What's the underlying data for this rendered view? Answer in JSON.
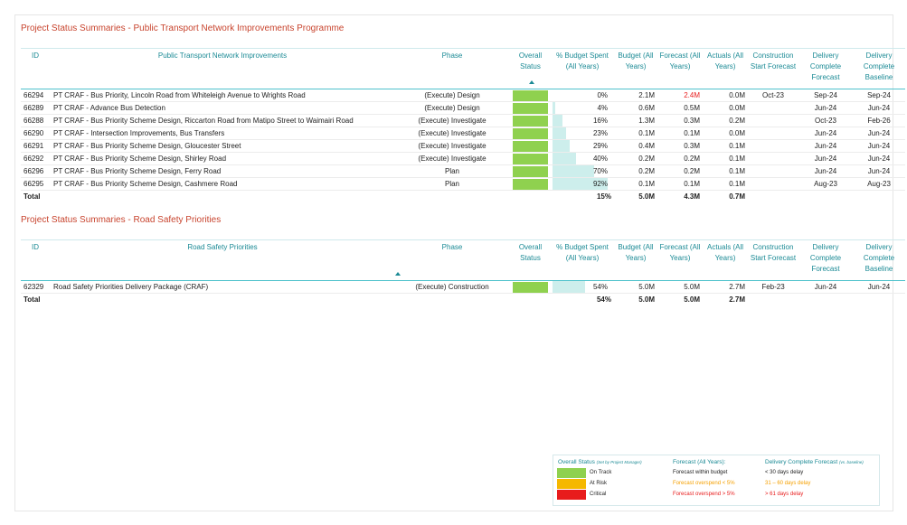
{
  "colors": {
    "on_track": "#8fd14f",
    "at_risk": "#f5b800",
    "critical": "#e81c1c",
    "header_teal": "#1b8a95",
    "title_red": "#c8442e",
    "over_budget_text": "#e81c1c",
    "budget_bar": "#cdeeec"
  },
  "section1": {
    "title": "Project Status Summaries - Public Transport Network Improvements Programme",
    "headers": {
      "id": "ID",
      "name": "Public Transport Network Improvements",
      "phase": "Phase",
      "overall_status": "Overall Status",
      "budget_spent": "% Budget Spent (All Years)",
      "budget": "Budget (All Years)",
      "forecast": "Forecast (All Years)",
      "actuals": "Actuals (All Years)",
      "construction_start": "Construction Start Forecast",
      "delivery_forecast": "Delivery Complete Forecast",
      "delivery_baseline": "Delivery Complete Baseline"
    },
    "rows": [
      {
        "id": "66294",
        "name": "PT CRAF - Bus Priority, Lincoln Road from Whiteleigh Avenue to Wrights Road",
        "phase": "(Execute) Design",
        "status": "on_track",
        "pct": "0%",
        "pct_value": 0,
        "budget": "2.1M",
        "forecast": "2.4M",
        "forecast_over": true,
        "actuals": "0.0M",
        "construction_start": "Oct-23",
        "delivery_forecast": "Sep-24",
        "delivery_baseline": "Sep-24"
      },
      {
        "id": "66289",
        "name": "PT CRAF - Advance Bus Detection",
        "phase": "(Execute) Design",
        "status": "on_track",
        "pct": "4%",
        "pct_value": 4,
        "budget": "0.6M",
        "forecast": "0.5M",
        "forecast_over": false,
        "actuals": "0.0M",
        "construction_start": "",
        "delivery_forecast": "Jun-24",
        "delivery_baseline": "Jun-24"
      },
      {
        "id": "66288",
        "name": "PT CRAF - Bus Priority Scheme Design, Riccarton Road from Matipo Street to Waimairi Road",
        "phase": "(Execute) Investigate",
        "status": "on_track",
        "pct": "16%",
        "pct_value": 16,
        "budget": "1.3M",
        "forecast": "0.3M",
        "forecast_over": false,
        "actuals": "0.2M",
        "construction_start": "",
        "delivery_forecast": "Oct-23",
        "delivery_baseline": "Feb-26"
      },
      {
        "id": "66290",
        "name": "PT CRAF - Intersection Improvements, Bus Transfers",
        "phase": "(Execute) Investigate",
        "status": "on_track",
        "pct": "23%",
        "pct_value": 23,
        "budget": "0.1M",
        "forecast": "0.1M",
        "forecast_over": false,
        "actuals": "0.0M",
        "construction_start": "",
        "delivery_forecast": "Jun-24",
        "delivery_baseline": "Jun-24"
      },
      {
        "id": "66291",
        "name": "PT CRAF - Bus Priority Scheme Design, Gloucester Street",
        "phase": "(Execute) Investigate",
        "status": "on_track",
        "pct": "29%",
        "pct_value": 29,
        "budget": "0.4M",
        "forecast": "0.3M",
        "forecast_over": false,
        "actuals": "0.1M",
        "construction_start": "",
        "delivery_forecast": "Jun-24",
        "delivery_baseline": "Jun-24"
      },
      {
        "id": "66292",
        "name": "PT CRAF - Bus Priority Scheme Design, Shirley Road",
        "phase": "(Execute) Investigate",
        "status": "on_track",
        "pct": "40%",
        "pct_value": 40,
        "budget": "0.2M",
        "forecast": "0.2M",
        "forecast_over": false,
        "actuals": "0.1M",
        "construction_start": "",
        "delivery_forecast": "Jun-24",
        "delivery_baseline": "Jun-24"
      },
      {
        "id": "66296",
        "name": "PT CRAF - Bus Priority Scheme Design, Ferry Road",
        "phase": "Plan",
        "status": "on_track",
        "pct": "70%",
        "pct_value": 70,
        "budget": "0.2M",
        "forecast": "0.2M",
        "forecast_over": false,
        "actuals": "0.1M",
        "construction_start": "",
        "delivery_forecast": "Jun-24",
        "delivery_baseline": "Jun-24"
      },
      {
        "id": "66295",
        "name": "PT CRAF - Bus Priority Scheme Design, Cashmere Road",
        "phase": "Plan",
        "status": "on_track",
        "pct": "92%",
        "pct_value": 92,
        "budget": "0.1M",
        "forecast": "0.1M",
        "forecast_over": false,
        "actuals": "0.1M",
        "construction_start": "",
        "delivery_forecast": "Aug-23",
        "delivery_baseline": "Aug-23"
      }
    ],
    "total": {
      "label": "Total",
      "pct": "15%",
      "budget": "5.0M",
      "forecast": "4.3M",
      "actuals": "0.7M"
    }
  },
  "section2": {
    "title": "Project Status Summaries - Road Safety Priorities",
    "headers": {
      "id": "ID",
      "name": "Road Safety Priorities",
      "phase": "Phase",
      "overall_status": "Overall Status",
      "budget_spent": "% Budget Spent (All Years)",
      "budget": "Budget (All Years)",
      "forecast": "Forecast (All Years)",
      "actuals": "Actuals (All Years)",
      "construction_start": "Construction Start Forecast",
      "delivery_forecast": "Delivery Complete Forecast",
      "delivery_baseline": "Delivery Complete Baseline"
    },
    "rows": [
      {
        "id": "62329",
        "name": "Road Safety Priorities Delivery Package (CRAF)",
        "phase": "(Execute) Construction",
        "status": "on_track",
        "pct": "54%",
        "pct_value": 54,
        "budget": "5.0M",
        "forecast": "5.0M",
        "forecast_over": false,
        "actuals": "2.7M",
        "construction_start": "Feb-23",
        "delivery_forecast": "Jun-24",
        "delivery_baseline": "Jun-24"
      }
    ],
    "total": {
      "label": "Total",
      "pct": "54%",
      "budget": "5.0M",
      "forecast": "5.0M",
      "actuals": "2.7M"
    }
  },
  "legend": {
    "status_title": "Overall Status",
    "status_subtitle": "(Set by Project Manager)",
    "on_track": "On Track",
    "at_risk": "At Risk",
    "critical": "Critical",
    "forecast_title": "Forecast (All Years):",
    "forecast_within": "Forecast within budget",
    "forecast_overspend_low": "Forecast overspend < 5%",
    "forecast_overspend_high": "Forecast overspend > 5%",
    "delivery_title": "Delivery Complete Forecast",
    "delivery_subtitle": "(vs. baseline)",
    "delivery_low": "< 30 days delay",
    "delivery_mid": "31 – 60 days delay",
    "delivery_high": "> 61 days delay"
  }
}
